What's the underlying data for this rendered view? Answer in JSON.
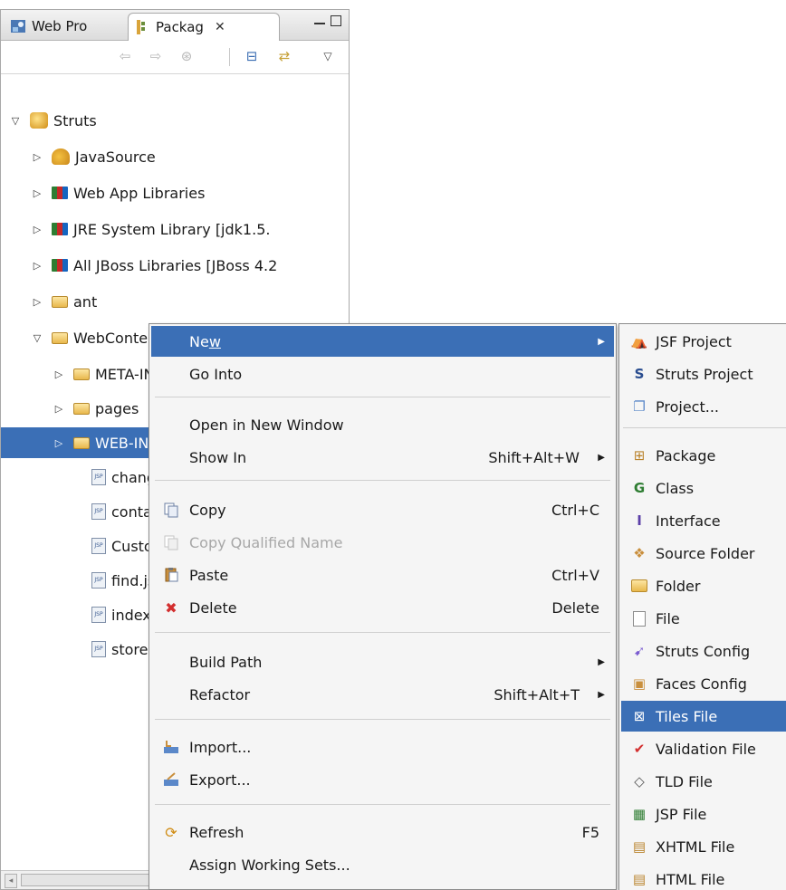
{
  "tabs": {
    "web_projects": "Web Pro",
    "package_explorer": "Packag",
    "close_glyph": "✕"
  },
  "tree": {
    "root": "Struts",
    "items": [
      {
        "label": "JavaSource",
        "icon": "package-root-icon"
      },
      {
        "label": "Web App Libraries",
        "icon": "library-icon"
      },
      {
        "label": "JRE System Library [jdk1.5.",
        "icon": "library-icon"
      },
      {
        "label": "All JBoss Libraries [JBoss 4.2",
        "icon": "library-icon"
      },
      {
        "label": "ant",
        "icon": "folder-icon"
      },
      {
        "label": "WebContent",
        "icon": "folder-icon"
      }
    ],
    "webcontent_children": [
      {
        "label": "META-INF",
        "icon": "folder-icon"
      },
      {
        "label": "pages",
        "icon": "folder-icon"
      },
      {
        "label": "WEB-INF",
        "icon": "folder-icon",
        "selected": true
      }
    ],
    "files": [
      "change.jsp",
      "contact.jsp",
      "Customer.jsp",
      "find.jsp",
      "index.jsp",
      "store.jsp"
    ]
  },
  "menu": {
    "new": {
      "label": "New",
      "mnemonic": "w"
    },
    "go_into": {
      "label": "Go Into"
    },
    "open_new_window": {
      "label": "Open in New Window"
    },
    "show_in": {
      "label": "Show In",
      "accel": "Shift+Alt+W"
    },
    "copy": {
      "label": "Copy",
      "accel": "Ctrl+C"
    },
    "copy_qualified": {
      "label": "Copy Qualified Name"
    },
    "paste": {
      "label": "Paste",
      "accel": "Ctrl+V"
    },
    "delete": {
      "label": "Delete",
      "accel": "Delete"
    },
    "build_path": {
      "label": "Build Path"
    },
    "refactor": {
      "label": "Refactor",
      "accel": "Shift+Alt+T"
    },
    "import": {
      "label": "Import..."
    },
    "export": {
      "label": "Export..."
    },
    "refresh": {
      "label": "Refresh",
      "accel": "F5"
    },
    "assign_working_sets": {
      "label": "Assign Working Sets..."
    }
  },
  "submenu": {
    "items": [
      "JSF Project",
      "Struts Project",
      "Project...",
      "Package",
      "Class",
      "Interface",
      "Source Folder",
      "Folder",
      "File",
      "Struts Config",
      "Faces Config",
      "Tiles File",
      "Validation File",
      "TLD File",
      "JSP File",
      "XHTML File",
      "HTML File"
    ],
    "highlighted": "Tiles File"
  },
  "colors": {
    "selection": "#3b6fb6",
    "menu_bg": "#f5f5f5"
  }
}
